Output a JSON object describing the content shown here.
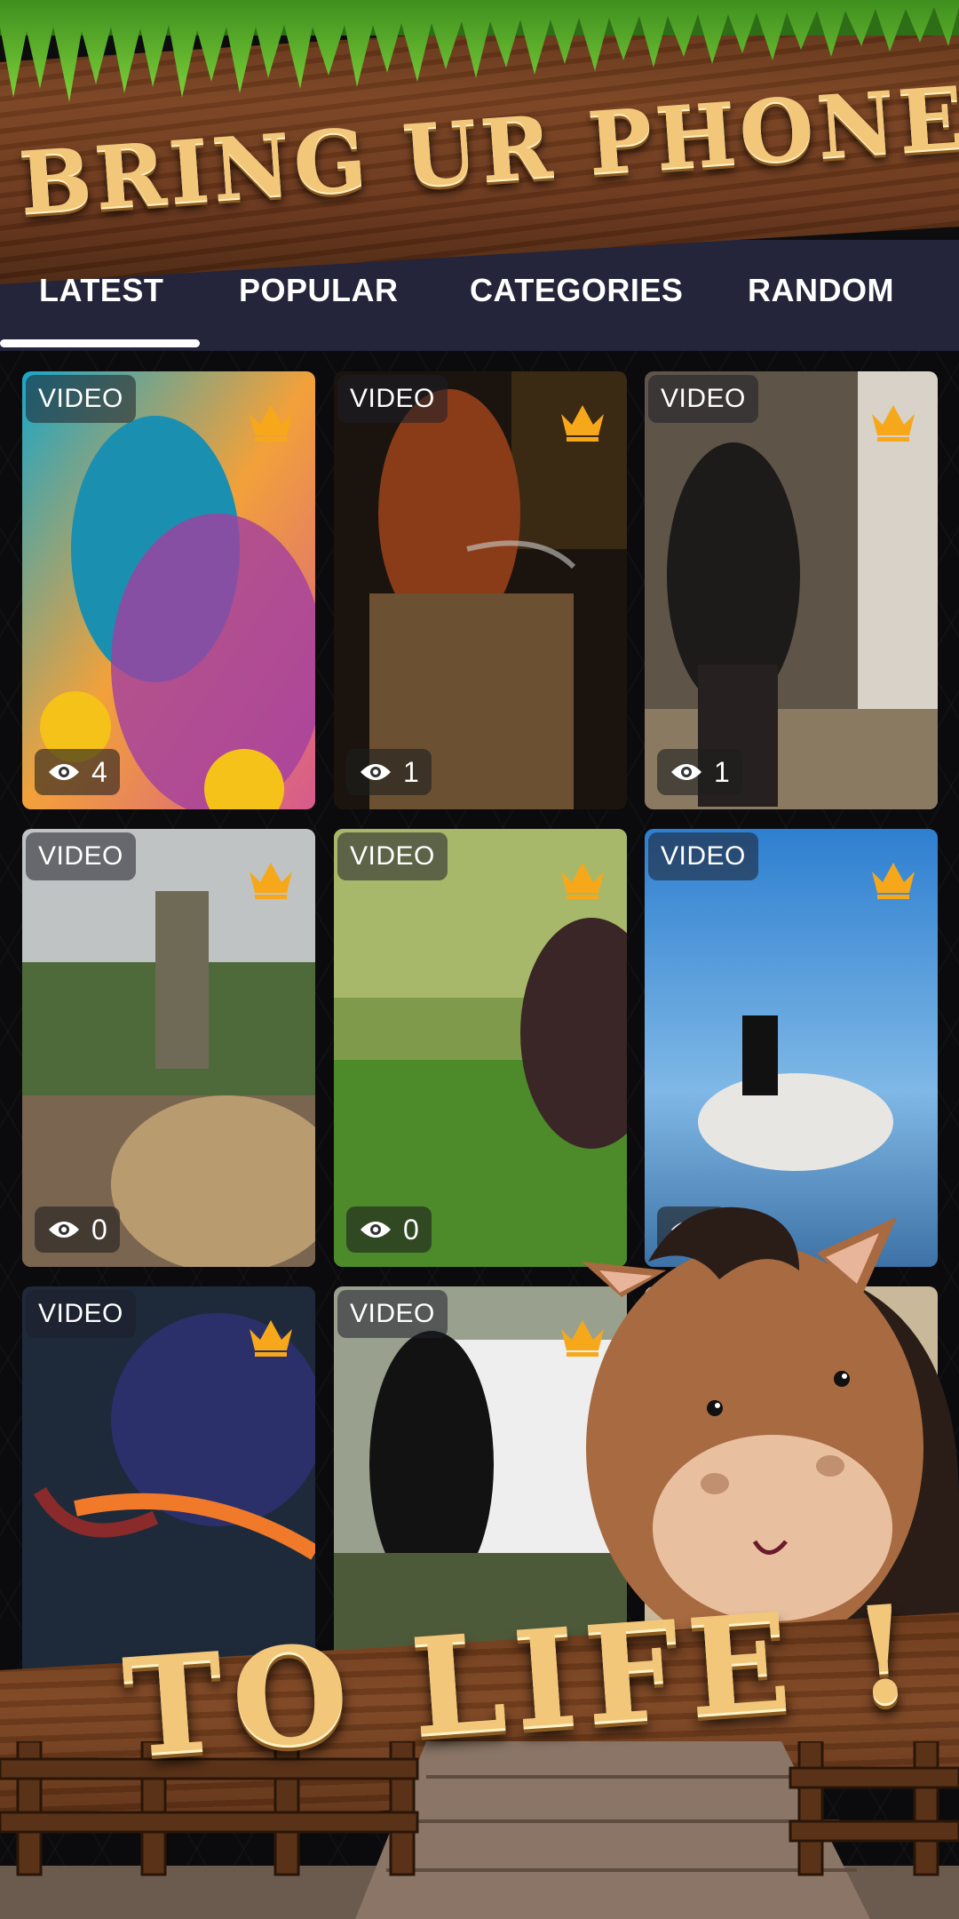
{
  "promo": {
    "headline_top": "BRING UR PHONE",
    "headline_bottom": "TO LIFE !"
  },
  "tabs": [
    {
      "label": "LATEST",
      "active": true
    },
    {
      "label": "POPULAR",
      "active": false
    },
    {
      "label": "CATEGORIES",
      "active": false
    },
    {
      "label": "RANDOM",
      "active": false
    }
  ],
  "cards": [
    {
      "badge": "VIDEO",
      "views": "4",
      "premium": true,
      "icon": "crown-icon"
    },
    {
      "badge": "VIDEO",
      "views": "1",
      "premium": true,
      "icon": "crown-icon"
    },
    {
      "badge": "VIDEO",
      "views": "1",
      "premium": true,
      "icon": "crown-icon"
    },
    {
      "badge": "VIDEO",
      "views": "0",
      "premium": true,
      "icon": "crown-icon"
    },
    {
      "badge": "VIDEO",
      "views": "0",
      "premium": true,
      "icon": "crown-icon"
    },
    {
      "badge": "VIDEO",
      "views": "",
      "premium": true,
      "icon": "crown-icon"
    },
    {
      "badge": "VIDEO",
      "views": "",
      "premium": true,
      "icon": "crown-icon"
    },
    {
      "badge": "VIDEO",
      "views": "",
      "premium": true,
      "icon": "crown-icon"
    }
  ],
  "colors": {
    "tabbar": "#24243a",
    "crown": "#f6a81a",
    "headline_gold": "#f3c77a",
    "wood": "#7a4220"
  }
}
